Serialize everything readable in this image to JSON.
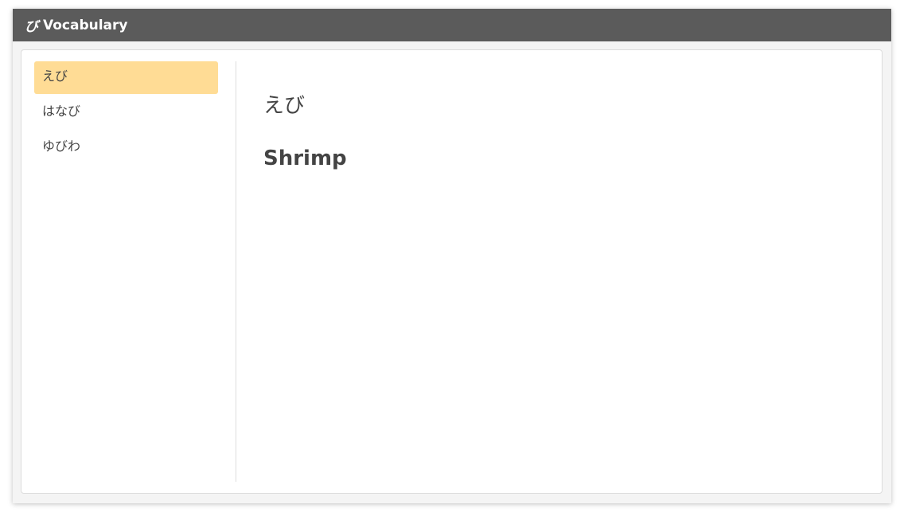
{
  "app": {
    "logo": "び",
    "title": "Vocabulary"
  },
  "words": [
    {
      "label": "えび",
      "selected": true
    },
    {
      "label": "はなび",
      "selected": false
    },
    {
      "label": "ゆびわ",
      "selected": false
    }
  ],
  "detail": {
    "kana": "えび",
    "meaning": "Shrimp"
  },
  "colors": {
    "titlebar": "#5b5b5b",
    "selected_item": "#ffdc95",
    "text": "#444444"
  }
}
